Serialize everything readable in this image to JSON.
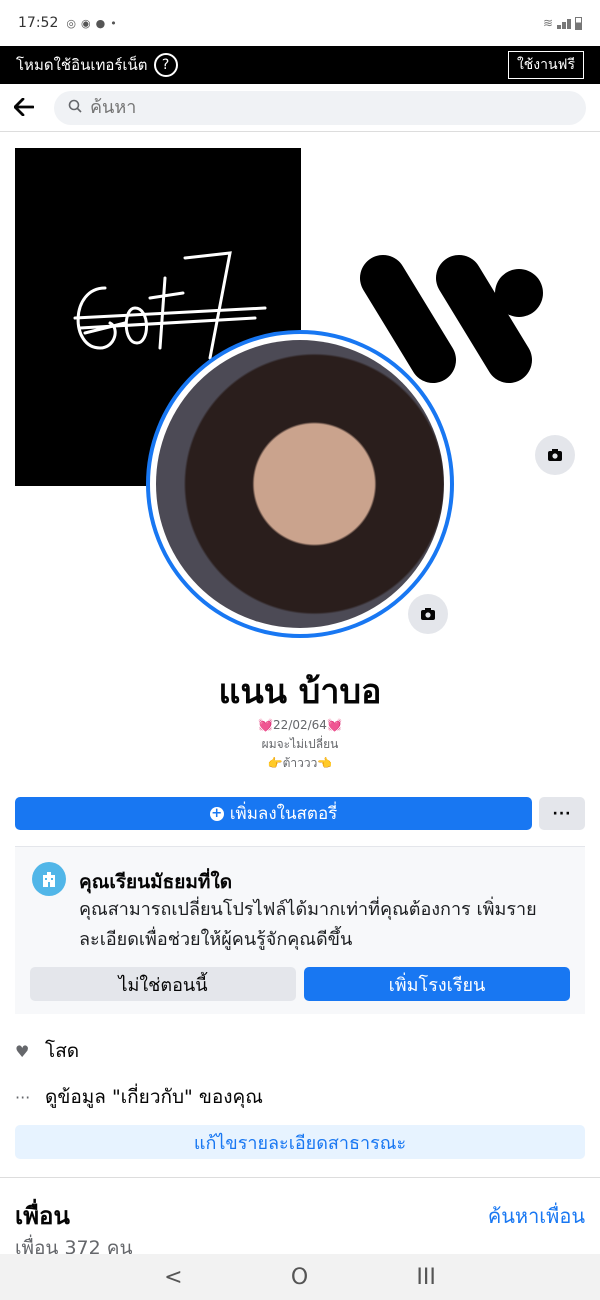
{
  "status_bar": {
    "time": "17:52"
  },
  "free_mode": {
    "label": "โหมดใช้อินเทอร์เน็ต",
    "help": "?",
    "use_free": "ใช้งานฟรี"
  },
  "search": {
    "placeholder": "ค้นหา"
  },
  "cover": {
    "left_text": "GOT7"
  },
  "profile": {
    "name": "แนน บ้าบอ",
    "bio": [
      "💓22/02/64💓",
      "ผมจะไม่เปลี่ยน",
      "👉ต้าววว👈"
    ]
  },
  "actions": {
    "add_story": "เพิ่มลงในสตอรี่",
    "more": "···"
  },
  "school_prompt": {
    "title": "คุณเรียนมัธยมที่ใด",
    "description": "คุณสามารถเปลี่ยนโปรไฟล์ได้มากเท่าที่คุณต้องการ เพิ่มรายละเอียดเพื่อช่วยให้ผู้คนรู้จักคุณดีขึ้น",
    "not_now": "ไม่ใช่ตอนนี้",
    "add_school": "เพิ่มโรงเรียน"
  },
  "details": {
    "relationship": "โสด",
    "about": "ดูข้อมูล \"เกี่ยวกับ\" ของคุณ",
    "edit_public": "แก้ไขรายละเอียดสาธารณะ"
  },
  "friends": {
    "title": "เพื่อน",
    "find": "ค้นหาเพื่อน",
    "count": "เพื่อน 372 คน"
  },
  "nav": {
    "back": "<",
    "home": "O",
    "recents": "III"
  },
  "colors": {
    "accent": "#1877f2",
    "school_icon": "#51b6e8"
  }
}
